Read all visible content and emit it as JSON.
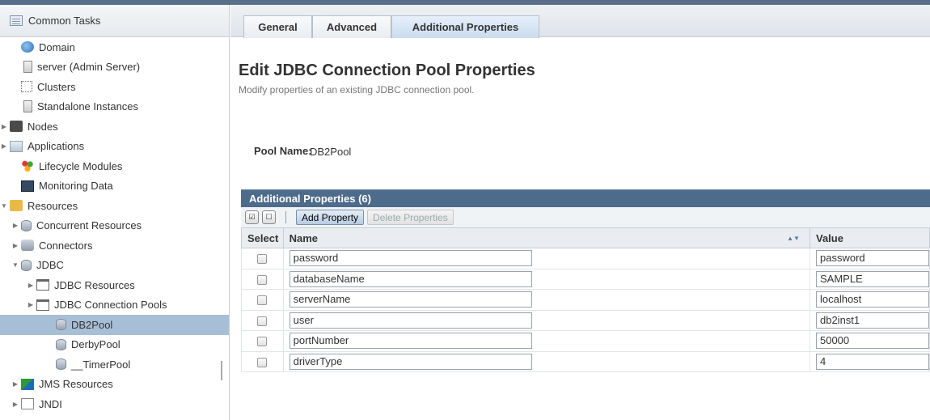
{
  "sidebar": {
    "header": "Common Tasks",
    "items": [
      {
        "label": "Domain",
        "icon": "globe-icon",
        "arrow": "",
        "level": 1
      },
      {
        "label": "server (Admin Server)",
        "icon": "server-icon",
        "arrow": "",
        "level": 1
      },
      {
        "label": "Clusters",
        "icon": "cluster-icon",
        "arrow": "",
        "level": 1
      },
      {
        "label": "Standalone Instances",
        "icon": "server-icon",
        "arrow": "",
        "level": 1
      },
      {
        "label": "Nodes",
        "icon": "nodes-icon",
        "arrow": "▶",
        "level": 0
      },
      {
        "label": "Applications",
        "icon": "applications-icon",
        "arrow": "▶",
        "level": 0
      },
      {
        "label": "Lifecycle Modules",
        "icon": "lifecycle-icon",
        "arrow": "",
        "level": 1
      },
      {
        "label": "Monitoring Data",
        "icon": "monitoring-icon",
        "arrow": "",
        "level": 1
      },
      {
        "label": "Resources",
        "icon": "resources-folder-icon",
        "arrow": "▼",
        "level": 0
      },
      {
        "label": "Concurrent Resources",
        "icon": "database-icon",
        "arrow": "▶",
        "level": 1
      },
      {
        "label": "Connectors",
        "icon": "connectors-icon",
        "arrow": "▶",
        "level": 1
      },
      {
        "label": "JDBC",
        "icon": "database-icon",
        "arrow": "▼",
        "level": 1
      },
      {
        "label": "JDBC Resources",
        "icon": "folder-icon",
        "arrow": "▶",
        "level": 2
      },
      {
        "label": "JDBC Connection Pools",
        "icon": "folder-icon",
        "arrow": "▶",
        "level": 2
      },
      {
        "label": "DB2Pool",
        "icon": "database-icon",
        "arrow": "",
        "level": 3,
        "selected": true
      },
      {
        "label": "DerbyPool",
        "icon": "database-icon",
        "arrow": "",
        "level": 3
      },
      {
        "label": "__TimerPool",
        "icon": "database-icon",
        "arrow": "",
        "level": 3
      },
      {
        "label": "JMS Resources",
        "icon": "jms-icon",
        "arrow": "▶",
        "level": 1
      },
      {
        "label": "JNDI",
        "icon": "jndi-icon",
        "arrow": "▶",
        "level": 1
      }
    ]
  },
  "tabs": [
    {
      "label": "General",
      "active": false
    },
    {
      "label": "Advanced",
      "active": false
    },
    {
      "label": "Additional Properties",
      "active": true
    }
  ],
  "page": {
    "title": "Edit JDBC Connection Pool Properties",
    "description": "Modify properties of an existing JDBC connection pool.",
    "pool_name_label": "Pool Name:",
    "pool_name_value": "DB2Pool"
  },
  "table": {
    "title": "Additional Properties (6)",
    "select_all_icon": "select-all-icon",
    "deselect_all_icon": "deselect-all-icon",
    "add_button": "Add Property",
    "delete_button": "Delete Properties",
    "columns": [
      "Select",
      "Name",
      "Value"
    ],
    "rows": [
      {
        "name": "password",
        "value": "password"
      },
      {
        "name": "databaseName",
        "value": "SAMPLE"
      },
      {
        "name": "serverName",
        "value": "localhost"
      },
      {
        "name": "user",
        "value": "db2inst1"
      },
      {
        "name": "portNumber",
        "value": "50000"
      },
      {
        "name": "driverType",
        "value": "4"
      }
    ]
  },
  "colors": {
    "table_title_bg": "#4d6b8b",
    "selected_item_bg": "#a7bfd6",
    "active_tab_bg": "#c9dcef"
  }
}
